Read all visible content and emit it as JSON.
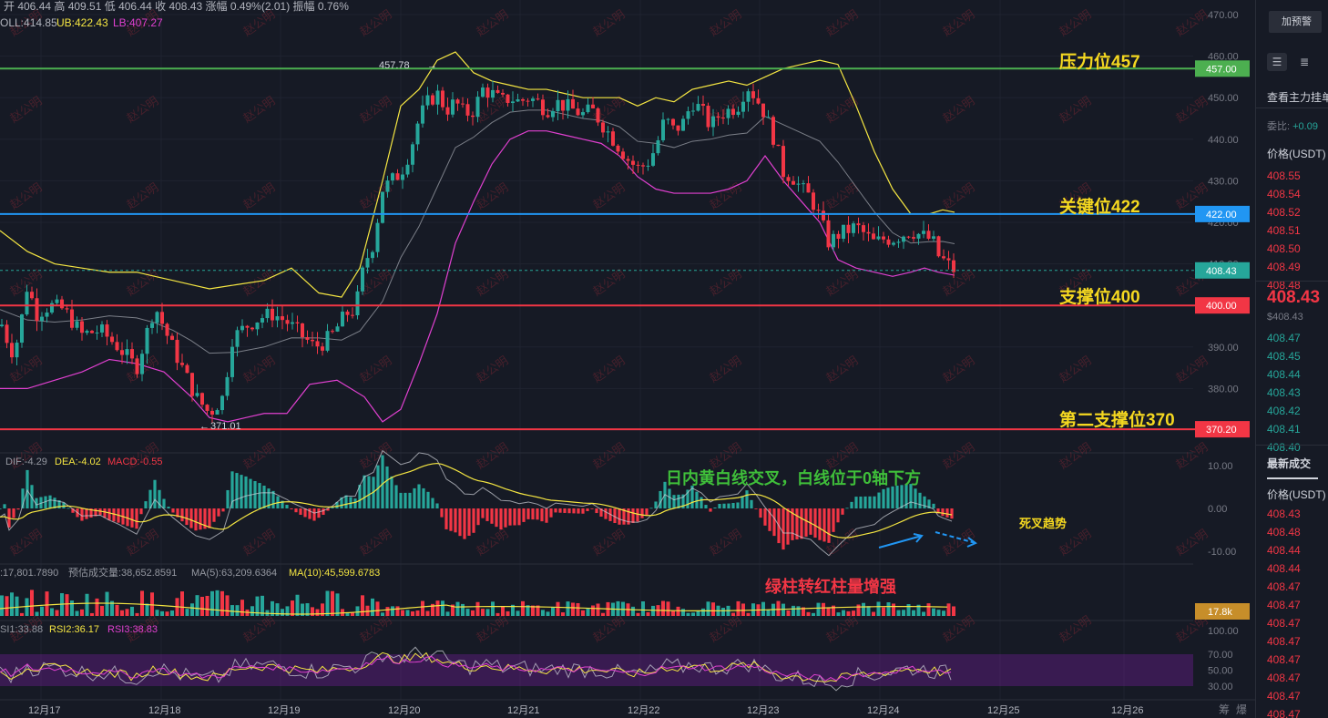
{
  "header": {
    "ohlc": "开 406.44  高 409.51  低 406.44  收 408.43  涨幅 0.49%(2.01)  振幅 0.76%",
    "boll": "OLL:414.85",
    "ub": "UB:422.43",
    "lb": "LB:407.27"
  },
  "panels": {
    "macd": {
      "dif": "DIF:-4.29",
      "dea": "DEA:-4.02",
      "macd": "MACD:-0.55"
    },
    "volume": {
      "vol": ":17,801.7890",
      "est": "预估成交量:38,652.8591",
      "ma5": "MA(5):63,209.6364",
      "ma10": "MA(10):45,599.6783"
    },
    "rsi": {
      "rsi1": "SI1:33.88",
      "rsi2": "RSI2:36.17",
      "rsi3": "RSI3:38.83"
    }
  },
  "annotations": {
    "resistance": "压力位457",
    "key": "关键位422",
    "support": "支撑位400",
    "support2": "第二支撑位370",
    "macd_note": "日内黄白线交叉，白线位于0轴下方",
    "death_cross": "死叉趋势",
    "volume_note": "绿柱转红柱量增强",
    "high_label": "457.78",
    "low_label": "371.01"
  },
  "watermark": "赵公明",
  "axis_scroll_label": "筹",
  "axis_scroll_label2": "爆",
  "side_panel": {
    "alert_button": "加预警",
    "order_book_title": "查看主力挂单",
    "ratio_label": "委比:",
    "ratio_value": "+0.09",
    "price_header": "价格(USDT)",
    "asks": [
      "408.55",
      "408.54",
      "408.52",
      "408.51",
      "408.50",
      "408.49",
      "408.48"
    ],
    "last_price": "408.43",
    "last_price_usd": "$408.43",
    "bids": [
      "408.47",
      "408.45",
      "408.44",
      "408.43",
      "408.42",
      "408.41",
      "408.40"
    ],
    "trades_title": "最新成交",
    "trades_header": "价格(USDT)",
    "trades": [
      "408.43",
      "408.48",
      "408.44",
      "408.44",
      "408.47",
      "408.47",
      "408.47",
      "408.47",
      "408.47",
      "408.47",
      "408.47",
      "408.47"
    ],
    "trade_colors": [
      "red",
      "red",
      "red",
      "red",
      "red",
      "red",
      "red",
      "red",
      "red",
      "red",
      "red",
      "red"
    ]
  },
  "colors": {
    "background": "#161a25",
    "up": "#26a69a",
    "down": "#f23645",
    "resistance": "#4caf50",
    "key": "#2196f3",
    "support": "#f23645",
    "annotation_yellow": "#f5d820",
    "boll_upper": "#f5e642",
    "boll_lower": "#e040d0",
    "boll_mid": "#9598a1"
  },
  "chart_data": {
    "type": "candlestick",
    "x_labels": [
      "12月17",
      "12月18",
      "12月19",
      "12月20",
      "12月21",
      "12月22",
      "12月23",
      "12月24",
      "12月25",
      "12月26"
    ],
    "y_ticks": [
      "470.00",
      "460.00",
      "450.00",
      "440.00",
      "430.00",
      "420.00",
      "410.00",
      "400.00",
      "390.00",
      "380.00",
      "370.00"
    ],
    "y_range": [
      365,
      472
    ],
    "close_path": [
      [
        0,
        395
      ],
      [
        5,
        396
      ],
      [
        10,
        388
      ],
      [
        20,
        392
      ],
      [
        30,
        405
      ],
      [
        40,
        398
      ],
      [
        55,
        400
      ],
      [
        70,
        399
      ],
      [
        90,
        393
      ],
      [
        110,
        394
      ],
      [
        130,
        390
      ],
      [
        150,
        385
      ],
      [
        170,
        400
      ],
      [
        185,
        392
      ],
      [
        200,
        385
      ],
      [
        215,
        378
      ],
      [
        230,
        374
      ],
      [
        245,
        378
      ],
      [
        255,
        392
      ],
      [
        270,
        395
      ],
      [
        285,
        397
      ],
      [
        300,
        398
      ],
      [
        315,
        396
      ],
      [
        330,
        393
      ],
      [
        345,
        390
      ],
      [
        355,
        391
      ],
      [
        365,
        393
      ],
      [
        380,
        398
      ],
      [
        390,
        399
      ],
      [
        400,
        410
      ],
      [
        410,
        415
      ],
      [
        420,
        428
      ],
      [
        430,
        430
      ],
      [
        440,
        432
      ],
      [
        450,
        437
      ],
      [
        460,
        445
      ],
      [
        470,
        449
      ],
      [
        480,
        451
      ],
      [
        490,
        447
      ],
      [
        500,
        449
      ],
      [
        510,
        446
      ],
      [
        520,
        447
      ],
      [
        530,
        452
      ],
      [
        540,
        451
      ],
      [
        550,
        449
      ],
      [
        560,
        450
      ],
      [
        570,
        449
      ],
      [
        580,
        450
      ],
      [
        590,
        449
      ],
      [
        600,
        447
      ],
      [
        610,
        449
      ],
      [
        620,
        448
      ],
      [
        630,
        447
      ],
      [
        640,
        446
      ],
      [
        650,
        447
      ],
      [
        660,
        444
      ],
      [
        670,
        441
      ],
      [
        680,
        438
      ],
      [
        690,
        435
      ],
      [
        700,
        433
      ],
      [
        710,
        434
      ],
      [
        720,
        438
      ],
      [
        730,
        445
      ],
      [
        740,
        442
      ],
      [
        750,
        444
      ],
      [
        760,
        449
      ],
      [
        770,
        447
      ],
      [
        780,
        443
      ],
      [
        790,
        446
      ],
      [
        800,
        447
      ],
      [
        810,
        448
      ],
      [
        820,
        453
      ],
      [
        830,
        450
      ],
      [
        840,
        446
      ],
      [
        850,
        440
      ],
      [
        860,
        432
      ],
      [
        870,
        431
      ],
      [
        880,
        428
      ],
      [
        890,
        426
      ],
      [
        900,
        421
      ],
      [
        910,
        415
      ],
      [
        920,
        417
      ],
      [
        930,
        418
      ],
      [
        940,
        419
      ],
      [
        950,
        417
      ],
      [
        960,
        415
      ],
      [
        970,
        416
      ],
      [
        980,
        416
      ],
      [
        990,
        417
      ],
      [
        1000,
        418
      ],
      [
        1010,
        417
      ],
      [
        1020,
        416
      ],
      [
        1025,
        415
      ],
      [
        1030,
        412
      ],
      [
        1040,
        410
      ],
      [
        1048,
        408.43
      ]
    ],
    "boll_upper_path": [
      [
        0,
        418
      ],
      [
        30,
        413
      ],
      [
        60,
        410
      ],
      [
        90,
        409
      ],
      [
        120,
        408
      ],
      [
        150,
        408
      ],
      [
        170,
        407
      ],
      [
        190,
        406
      ],
      [
        210,
        405
      ],
      [
        230,
        404
      ],
      [
        260,
        405
      ],
      [
        290,
        406
      ],
      [
        320,
        409
      ],
      [
        350,
        403
      ],
      [
        375,
        402
      ],
      [
        395,
        409
      ],
      [
        420,
        430
      ],
      [
        440,
        448
      ],
      [
        460,
        452
      ],
      [
        480,
        459
      ],
      [
        500,
        461
      ],
      [
        520,
        456
      ],
      [
        540,
        454
      ],
      [
        560,
        453
      ],
      [
        580,
        452
      ],
      [
        600,
        452
      ],
      [
        620,
        451
      ],
      [
        640,
        450
      ],
      [
        660,
        450
      ],
      [
        680,
        450
      ],
      [
        700,
        448
      ],
      [
        720,
        450
      ],
      [
        740,
        449
      ],
      [
        760,
        452
      ],
      [
        780,
        453
      ],
      [
        800,
        454
      ],
      [
        820,
        453
      ],
      [
        840,
        455
      ],
      [
        860,
        457
      ],
      [
        880,
        458
      ],
      [
        900,
        459
      ],
      [
        920,
        458
      ],
      [
        940,
        448
      ],
      [
        960,
        437
      ],
      [
        980,
        428
      ],
      [
        1000,
        422
      ],
      [
        1020,
        422
      ],
      [
        1035,
        423
      ],
      [
        1048,
        422.43
      ]
    ],
    "boll_lower_path": [
      [
        0,
        380
      ],
      [
        30,
        380
      ],
      [
        60,
        382
      ],
      [
        90,
        384
      ],
      [
        120,
        387
      ],
      [
        150,
        386
      ],
      [
        180,
        384
      ],
      [
        210,
        378
      ],
      [
        230,
        373
      ],
      [
        250,
        372
      ],
      [
        270,
        373
      ],
      [
        290,
        374
      ],
      [
        315,
        374
      ],
      [
        340,
        381
      ],
      [
        370,
        382
      ],
      [
        400,
        378
      ],
      [
        420,
        372
      ],
      [
        440,
        375
      ],
      [
        460,
        386
      ],
      [
        480,
        398
      ],
      [
        500,
        415
      ],
      [
        520,
        425
      ],
      [
        540,
        434
      ],
      [
        560,
        440
      ],
      [
        580,
        442
      ],
      [
        600,
        442
      ],
      [
        620,
        441
      ],
      [
        640,
        440
      ],
      [
        660,
        439
      ],
      [
        680,
        436
      ],
      [
        700,
        431
      ],
      [
        720,
        428
      ],
      [
        740,
        427
      ],
      [
        760,
        427
      ],
      [
        780,
        427
      ],
      [
        800,
        428
      ],
      [
        820,
        430
      ],
      [
        840,
        436
      ],
      [
        860,
        430
      ],
      [
        880,
        425
      ],
      [
        900,
        420
      ],
      [
        920,
        411
      ],
      [
        940,
        409
      ],
      [
        960,
        408
      ],
      [
        980,
        407
      ],
      [
        1000,
        408
      ],
      [
        1015,
        409
      ],
      [
        1030,
        408
      ],
      [
        1048,
        407.27
      ]
    ],
    "levels": [
      {
        "value": 457.0,
        "label": "457.00",
        "color": "#4caf50"
      },
      {
        "value": 422.0,
        "label": "422.00",
        "color": "#2196f3"
      },
      {
        "value": 400.0,
        "label": "400.00",
        "color": "#f23645"
      },
      {
        "value": 370.2,
        "label": "370.20",
        "color": "#f23645"
      }
    ],
    "current_price": {
      "value": 408.43,
      "label": "408.43"
    },
    "high": 457.78,
    "low": 371.01,
    "macd_ticks": [
      "10.00",
      "0.00",
      "-10.00"
    ],
    "macd_range": [
      -12,
      12
    ],
    "volume_ticks": [
      "17.8k"
    ],
    "rsi_ticks": [
      "100.00",
      "70.00",
      "50.00",
      "30.00"
    ],
    "rsi_range": [
      25,
      100
    ]
  }
}
